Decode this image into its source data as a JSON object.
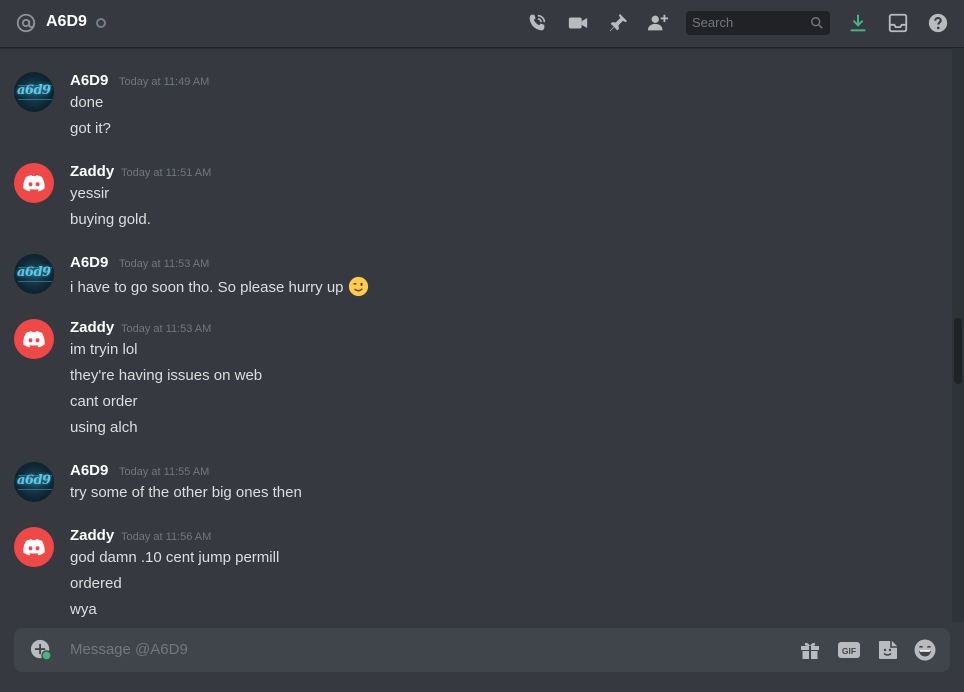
{
  "header": {
    "title": "A6D9",
    "search_placeholder": "Search"
  },
  "messages": [
    {
      "author": "A6D9",
      "timestamp": "Today at 11:49 AM",
      "avatar_text": "a6d9",
      "lines": [
        "done",
        "got it?"
      ]
    },
    {
      "author": "Zaddy",
      "timestamp": "Today at 11:51 AM",
      "lines": [
        "yessir",
        "buying gold."
      ]
    },
    {
      "author": "A6D9",
      "timestamp": "Today at 11:53 AM",
      "avatar_text": "a6d9",
      "lines": [
        "i have to go soon tho. So please hurry up"
      ],
      "emoji": "winking-face"
    },
    {
      "author": "Zaddy",
      "timestamp": "Today at 11:53 AM",
      "lines": [
        "im tryin lol",
        "they're having issues on web",
        "cant order",
        "using alch"
      ]
    },
    {
      "author": "A6D9",
      "timestamp": "Today at 11:55 AM",
      "avatar_text": "a6d9",
      "lines": [
        "try some of the other big ones then"
      ]
    },
    {
      "author": "Zaddy",
      "timestamp": "Today at 11:56 AM",
      "lines": [
        "god damn .10 cent jump permill",
        "ordered",
        "wya"
      ]
    }
  ],
  "composer": {
    "placeholder": "Message @A6D9"
  },
  "colors": {
    "background": "#36393f",
    "composer": "#40444b",
    "discord_red": "#f04747",
    "download_green": "#43b581"
  }
}
